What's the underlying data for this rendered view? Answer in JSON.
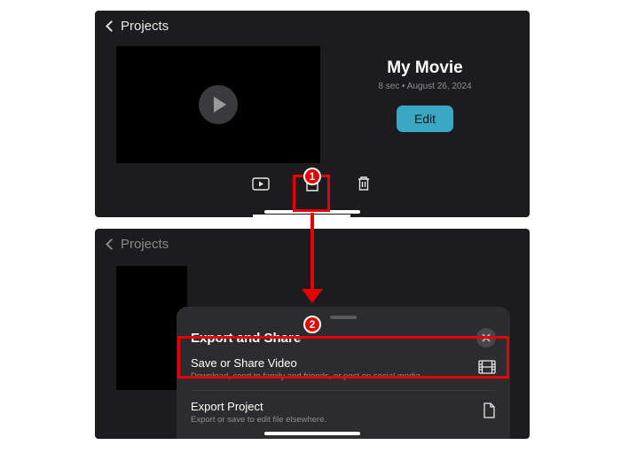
{
  "nav": {
    "back_label": "Projects"
  },
  "project": {
    "title": "My Movie",
    "meta": "8 sec • August 26, 2024",
    "edit_label": "Edit"
  },
  "toolbar": {
    "play_icon": "play-rect",
    "share_icon": "share",
    "trash_icon": "trash"
  },
  "sheet": {
    "title": "Export and Share",
    "items": [
      {
        "title": "Save or Share Video",
        "subtitle": "Download, send to family and friends, or post on social media.",
        "icon": "film"
      },
      {
        "title": "Export Project",
        "subtitle": "Export or save to edit file elsewhere.",
        "icon": "doc"
      }
    ]
  },
  "annotations": {
    "badge1": "1",
    "badge2": "2",
    "highlight_color": "#e60000"
  }
}
